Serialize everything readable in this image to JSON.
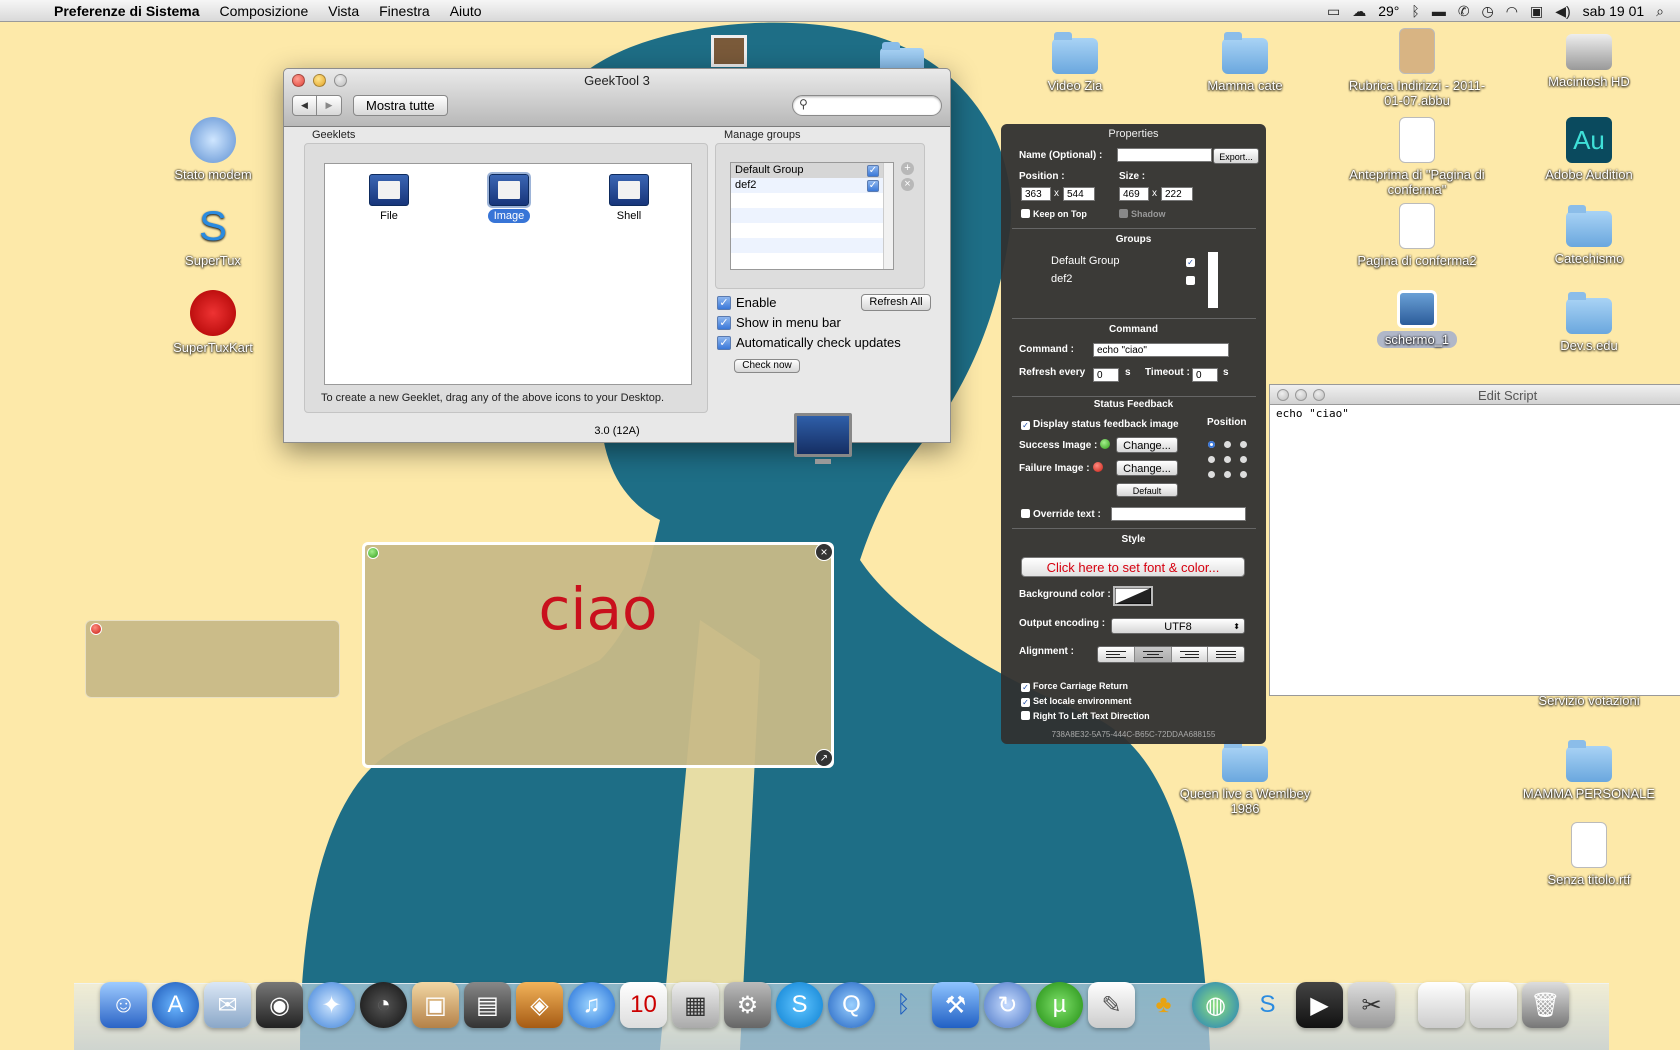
{
  "menubar": {
    "app_name": "Preferenze di Sistema",
    "items": [
      "Composizione",
      "Vista",
      "Finestra",
      "Aiuto"
    ],
    "temperature": "29°",
    "clock": "sab 19 01"
  },
  "desktop_icons": [
    {
      "label": "Stato modem",
      "type": "app"
    },
    {
      "label": "SuperTux",
      "type": "app"
    },
    {
      "label": "SuperTuxKart",
      "type": "app"
    },
    {
      "label": "Video Zia",
      "type": "folder"
    },
    {
      "label": "Mamma cate",
      "type": "folder"
    },
    {
      "label": "Rubrica Indirizzi - 2011-01-07.abbu",
      "type": "doc"
    },
    {
      "label": "Macintosh HD",
      "type": "drive"
    },
    {
      "label": "Anteprima di \"Pagina di conferma\"",
      "type": "doc"
    },
    {
      "label": "Adobe Audition",
      "type": "app"
    },
    {
      "label": "Pagina di conferma2",
      "type": "doc"
    },
    {
      "label": "Catechismo",
      "type": "folder"
    },
    {
      "label": "schermo_1",
      "type": "image"
    },
    {
      "label": "Dev.s.edu",
      "type": "folder"
    },
    {
      "label": "Servizio votazioni",
      "type": "folder"
    },
    {
      "label": "Queen live a Wemlbey 1986",
      "type": "folder"
    },
    {
      "label": "MAMMA PERSONALE",
      "type": "folder"
    },
    {
      "label": "Senza titolo.rtf",
      "type": "doc"
    }
  ],
  "geektool": {
    "title": "GeekTool 3",
    "show_all": "Mostra tutte",
    "search_placeholder": "",
    "geeklets_label": "Geeklets",
    "geeklet_types": [
      {
        "label": "File"
      },
      {
        "label": "Image"
      },
      {
        "label": "Shell"
      }
    ],
    "hint": "To create a new Geeklet, drag any of the above icons to your Desktop.",
    "manage_groups_label": "Manage groups",
    "groups": [
      {
        "name": "Default Group",
        "checked": true
      },
      {
        "name": "def2",
        "checked": true
      }
    ],
    "enable_label": "Enable",
    "refresh_all": "Refresh All",
    "show_menu_bar_label": "Show in menu bar",
    "auto_check_label": "Automatically check updates",
    "check_now": "Check now",
    "version": "3.0 (12A)"
  },
  "properties": {
    "title": "Properties",
    "name_label": "Name (Optional) :",
    "name_value": "",
    "export": "Export...",
    "position_label": "Position :",
    "pos_x": "363",
    "pos_y": "544",
    "size_label": "Size :",
    "size_w": "469",
    "size_h": "222",
    "times": "x",
    "keep_on_top": "Keep on Top",
    "shadow": "Shadow",
    "groups_head": "Groups",
    "groups": [
      "Default Group",
      "def2"
    ],
    "command_head": "Command",
    "command_label": "Command :",
    "command_value": "echo \"ciao\"",
    "refresh_label": "Refresh every",
    "refresh_value": "0",
    "seconds_unit": "s",
    "timeout_label": "Timeout :",
    "timeout_value": "0",
    "status_head": "Status Feedback",
    "display_status": "Display status feedback image",
    "position_label2": "Position",
    "success_label": "Success Image :",
    "failure_label": "Failure Image :",
    "change": "Change...",
    "default": "Default",
    "override_label": "Override text :",
    "style_head": "Style",
    "font_button": "Click here to set font & color...",
    "bg_color_label": "Background color :",
    "encoding_label": "Output encoding :",
    "encoding_value": "UTF8",
    "alignment_label": "Alignment :",
    "force_cr": "Force Carriage Return",
    "set_locale": "Set locale environment",
    "rtl": "Right To Left Text Direction",
    "uuid": "738A8E32-5A75-444C-B65C-72DDAA688155"
  },
  "edit_script": {
    "title": "Edit Script",
    "content": "echo \"ciao\""
  },
  "geeklet_output": {
    "text": "ciao"
  },
  "colors": {
    "desktop_bg": "#fde9a9",
    "silhouette": "#1e6e86",
    "accent": "#3875d7",
    "ciao_red": "#c9101d"
  }
}
